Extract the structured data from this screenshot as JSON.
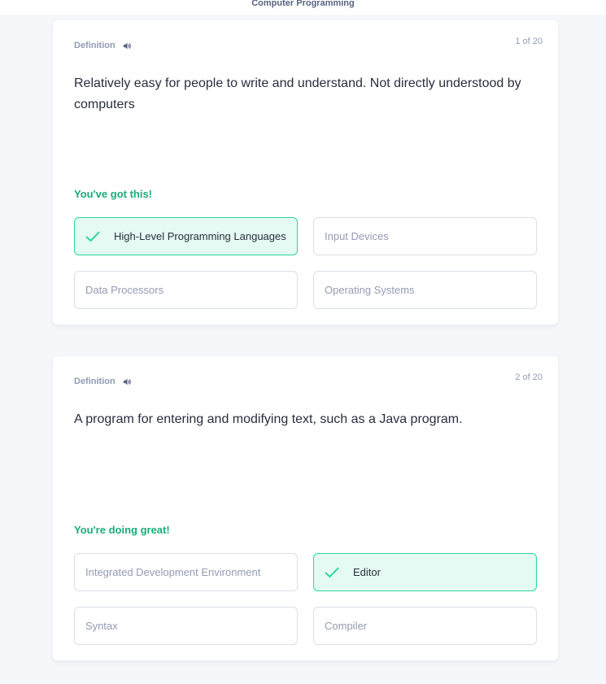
{
  "header": {
    "title": "Computer Programming"
  },
  "cards": [
    {
      "label": "Definition",
      "counter": "1 of 20",
      "prompt": "Relatively easy for people to write and understand. Not directly understood by computers",
      "feedback": "You've got this!",
      "options": [
        {
          "text": "High-Level Programming Languages",
          "state": "correct"
        },
        {
          "text": "Input Devices",
          "state": "default"
        },
        {
          "text": "Data Processors",
          "state": "default"
        },
        {
          "text": "Operating Systems",
          "state": "default"
        }
      ]
    },
    {
      "label": "Definition",
      "counter": "2 of 20",
      "prompt": "A program for entering and modifying text, such as a Java program.",
      "feedback": "You're doing great!",
      "options": [
        {
          "text": "Integrated Development Environment",
          "state": "default"
        },
        {
          "text": "Editor",
          "state": "correct"
        },
        {
          "text": "Syntax",
          "state": "default"
        },
        {
          "text": "Compiler",
          "state": "default"
        }
      ]
    }
  ],
  "colors": {
    "background": "#f6f7fb",
    "card": "#ffffff",
    "feedback_green": "#18ae79",
    "correct_bg": "#e4faf2",
    "correct_border": "#2dd6a0",
    "muted_text": "#939bb4"
  },
  "icons": {
    "audio": "speaker-icon",
    "correct": "checkmark-icon"
  }
}
